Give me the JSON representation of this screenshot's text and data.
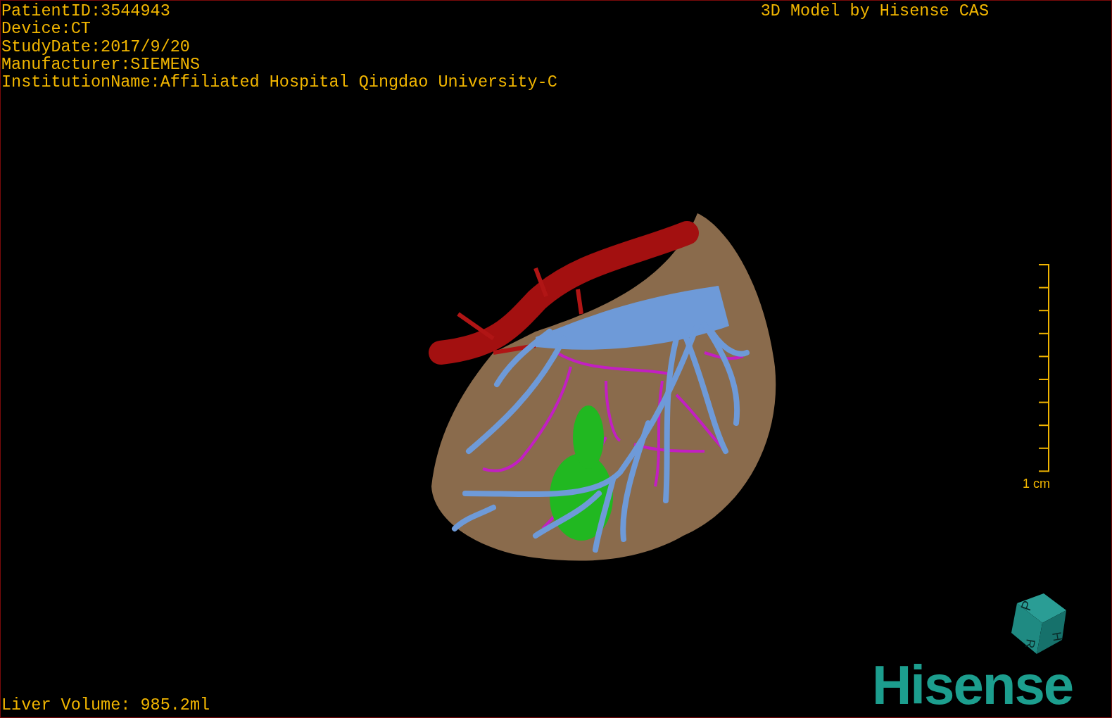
{
  "info_lines": [
    "PatientID:3544943",
    "Device:CT",
    "StudyDate:2017/9/20",
    "Manufacturer:SIEMENS",
    "InstitutionName:Affiliated Hospital Qingdao University-C"
  ],
  "title": "3D Model by Hisense CAS",
  "scale_bar": {
    "label": "1 cm"
  },
  "orientation_cube": {
    "faces": [
      "P",
      "H",
      "R"
    ]
  },
  "logo": "Hisense",
  "footer": "Liver Volume: 985.2ml"
}
